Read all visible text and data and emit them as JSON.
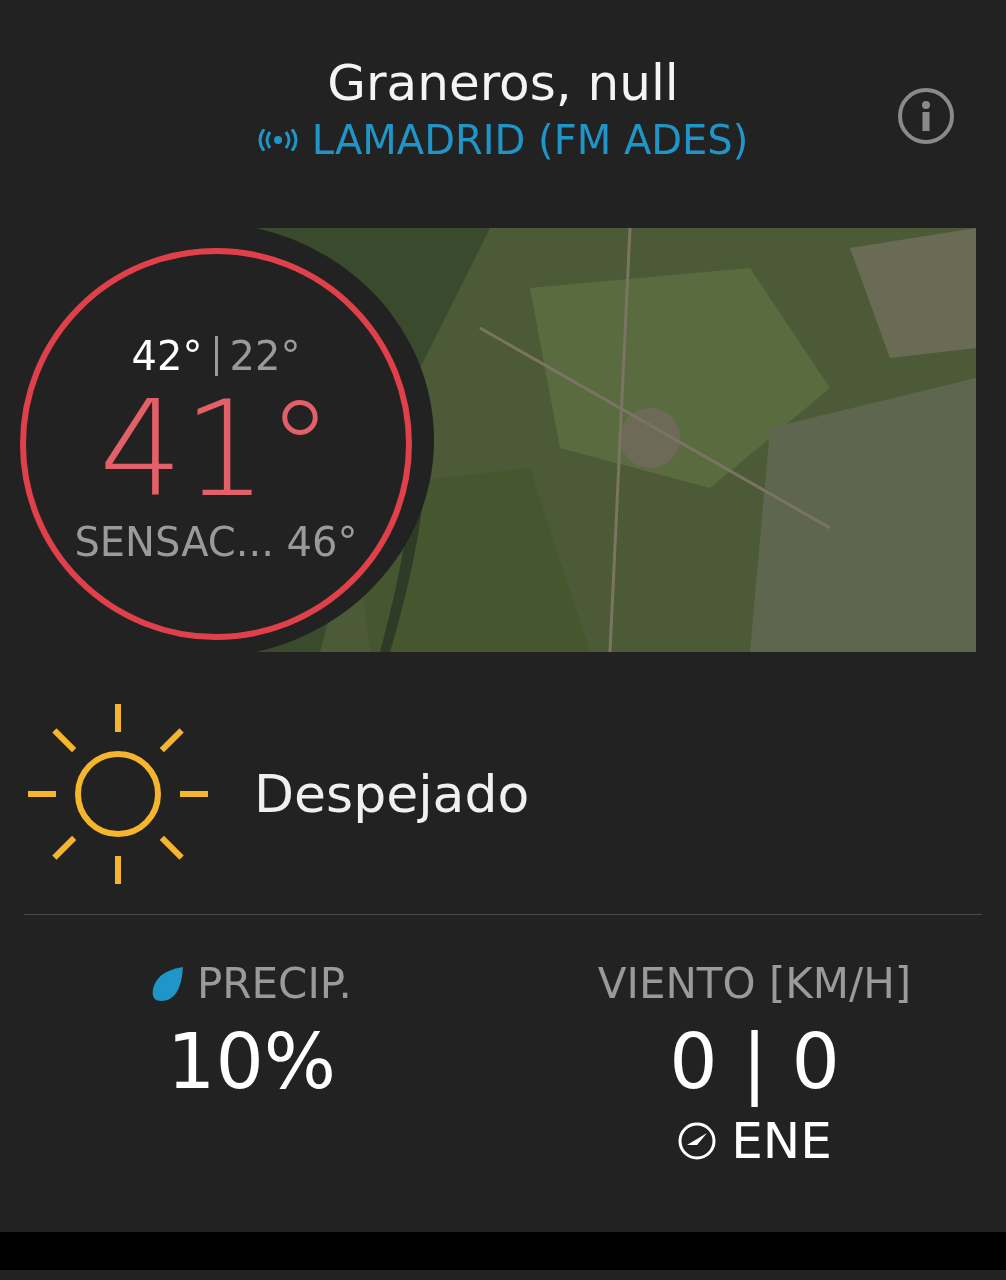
{
  "header": {
    "location": "Graneros, null",
    "station": "LAMADRID (FM ADES)"
  },
  "current": {
    "high": "42°",
    "low": "22°",
    "temperature": "41°",
    "feels_like": "SENSAC... 46°"
  },
  "condition": {
    "text": "Despejado"
  },
  "precipitation": {
    "label": "PRECIP.",
    "value": "10%"
  },
  "wind": {
    "label": "VIENTO [KM/H]",
    "value": "0 | 0",
    "direction": "ENE"
  }
}
